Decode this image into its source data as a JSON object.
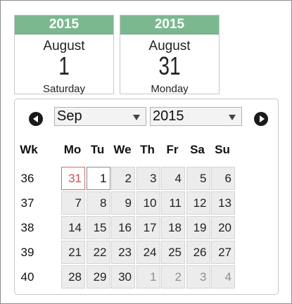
{
  "start_card": {
    "year": "2015",
    "month": "August",
    "day": "1",
    "weekday": "Saturday"
  },
  "end_card": {
    "year": "2015",
    "month": "August",
    "day": "31",
    "weekday": "Monday"
  },
  "calendar": {
    "month_value": "Sep",
    "year_value": "2015",
    "headers": [
      "Wk",
      "Mo",
      "Tu",
      "We",
      "Th",
      "Fr",
      "Sa",
      "Su"
    ],
    "weeks": [
      {
        "wk": "36",
        "days": [
          "31",
          "1",
          "2",
          "3",
          "4",
          "5",
          "6"
        ],
        "other": [
          false,
          false,
          false,
          false,
          false,
          false,
          false
        ]
      },
      {
        "wk": "37",
        "days": [
          "7",
          "8",
          "9",
          "10",
          "11",
          "12",
          "13"
        ],
        "other": [
          false,
          false,
          false,
          false,
          false,
          false,
          false
        ]
      },
      {
        "wk": "38",
        "days": [
          "14",
          "15",
          "16",
          "17",
          "18",
          "19",
          "20"
        ],
        "other": [
          false,
          false,
          false,
          false,
          false,
          false,
          false
        ]
      },
      {
        "wk": "39",
        "days": [
          "21",
          "22",
          "23",
          "24",
          "25",
          "26",
          "27"
        ],
        "other": [
          false,
          false,
          false,
          false,
          false,
          false,
          false
        ]
      },
      {
        "wk": "40",
        "days": [
          "28",
          "29",
          "30",
          "1",
          "2",
          "3",
          "4"
        ],
        "other": [
          false,
          false,
          false,
          true,
          true,
          true,
          true
        ]
      }
    ],
    "highlighted_today": "31",
    "selected_day": "1"
  },
  "colors": {
    "header_green": "#7cb88f",
    "today_red": "#cc4d4d"
  },
  "icons": {
    "prev": "chevron-left-circle-icon",
    "next": "chevron-right-circle-icon",
    "dropdown": "dropdown-arrow-icon"
  }
}
